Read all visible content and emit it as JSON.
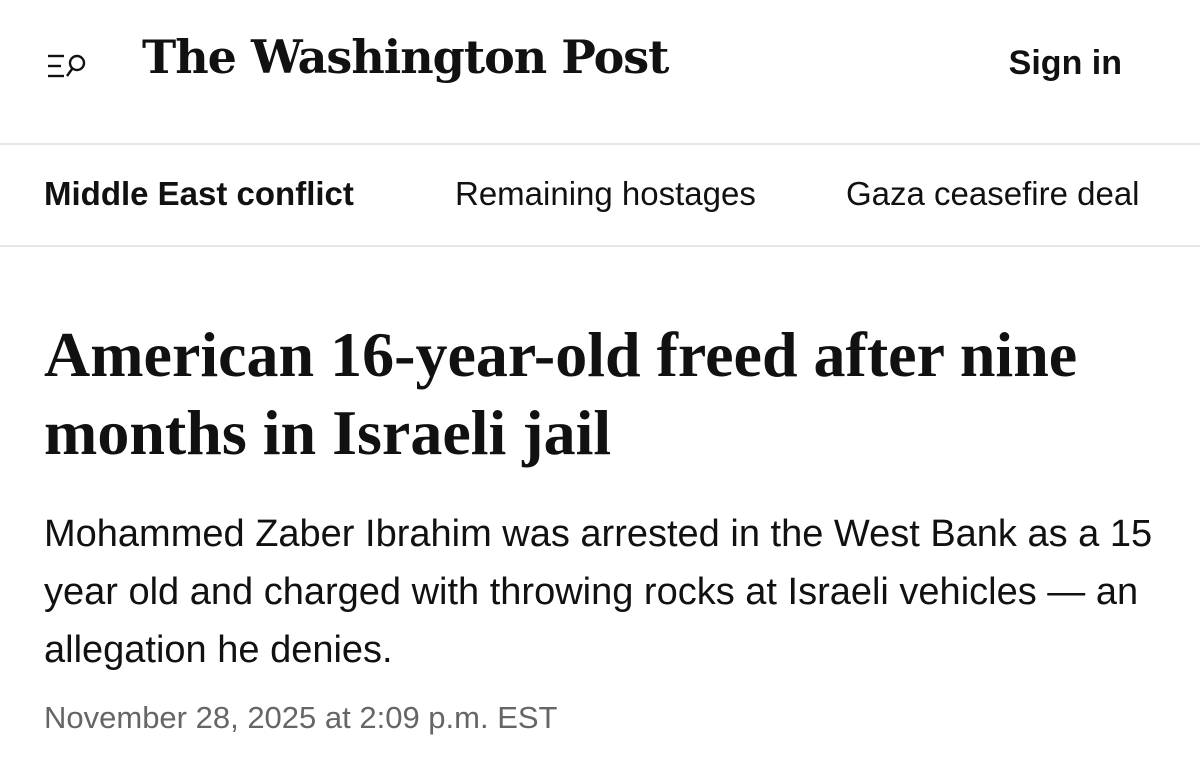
{
  "header": {
    "menu_icon": "menu-search-icon",
    "masthead": "The Washington Post",
    "sign_in_label": "Sign in"
  },
  "nav": {
    "items": [
      {
        "label": "Middle East conflict",
        "active": true
      },
      {
        "label": "Remaining hostages",
        "active": false
      },
      {
        "label": "Gaza ceasefire deal",
        "active": false
      }
    ]
  },
  "article": {
    "headline": "American 16-year-old freed after nine months in Israeli jail",
    "dek": "Mohammed Zaber Ibrahim was arrested in the West Bank as a 15 year old and charged with throwing rocks at Israeli vehicles — an allegation he denies.",
    "timestamp": "November 28, 2025 at 2:09 p.m. EST"
  }
}
